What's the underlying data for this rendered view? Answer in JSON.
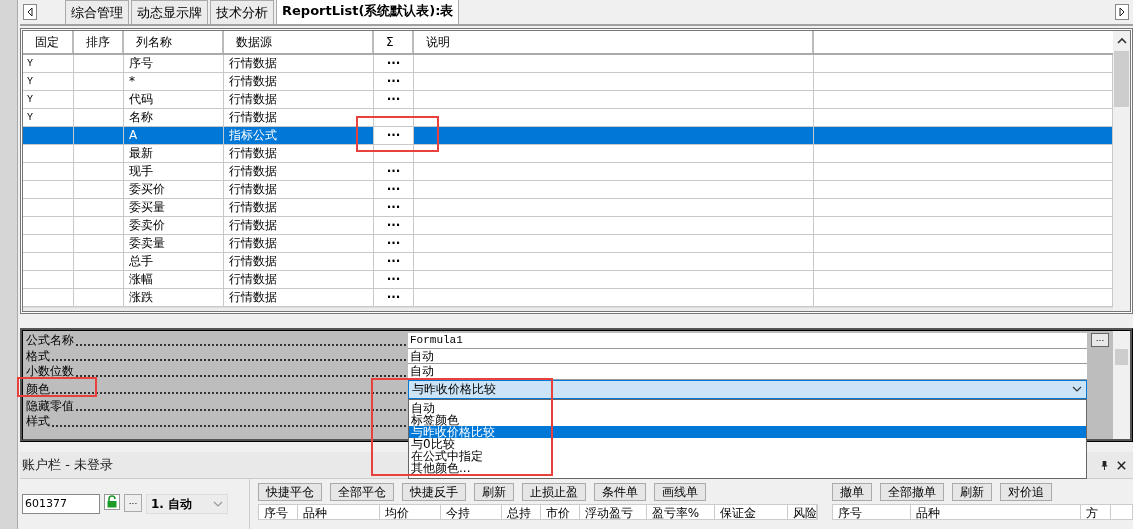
{
  "tabs": [
    {
      "label": "综合管理",
      "selected": false
    },
    {
      "label": "动态显示牌",
      "selected": false
    },
    {
      "label": "技术分析",
      "selected": false
    },
    {
      "label": "ReportList(系统默认表):表",
      "selected": true
    }
  ],
  "grid": {
    "columns": [
      "固定",
      "排序",
      "列名称",
      "数据源",
      "Σ",
      "说明"
    ],
    "rows": [
      {
        "fixed": "Y",
        "name": "序号",
        "source": "行情数据",
        "sum": "···",
        "selected": false
      },
      {
        "fixed": "Y",
        "name": "*",
        "source": "行情数据",
        "sum": "···",
        "selected": false
      },
      {
        "fixed": "Y",
        "name": "代码",
        "source": "行情数据",
        "sum": "···",
        "selected": false
      },
      {
        "fixed": "Y",
        "name": "名称",
        "source": "行情数据",
        "selected": false
      },
      {
        "name": "A",
        "source": "指标公式",
        "sum": "···",
        "selected": true,
        "highlighted": true
      },
      {
        "name": "最新",
        "source": "行情数据",
        "selected": false
      },
      {
        "name": "现手",
        "source": "行情数据",
        "sum": "···",
        "selected": false
      },
      {
        "name": "委买价",
        "source": "行情数据",
        "sum": "···",
        "selected": false
      },
      {
        "name": "委买量",
        "source": "行情数据",
        "sum": "···",
        "selected": false
      },
      {
        "name": "委卖价",
        "source": "行情数据",
        "sum": "···",
        "selected": false
      },
      {
        "name": "委卖量",
        "source": "行情数据",
        "sum": "···",
        "selected": false
      },
      {
        "name": "总手",
        "source": "行情数据",
        "sum": "···",
        "selected": false
      },
      {
        "name": "涨幅",
        "source": "行情数据",
        "sum": "···",
        "selected": false
      },
      {
        "name": "涨跌",
        "source": "行情数据",
        "sum": "···",
        "selected": false
      }
    ]
  },
  "properties": {
    "more_button": "...",
    "rows": [
      {
        "kind": "text",
        "label": "公式名称",
        "value": "Formula1"
      },
      {
        "kind": "text",
        "label": "格式",
        "value": "自动"
      },
      {
        "kind": "text",
        "label": "小数位数",
        "value": "自动"
      },
      {
        "kind": "combo",
        "label": "颜色",
        "value": "与昨收价格比较",
        "highlighted": true,
        "options": [
          {
            "label": "自动",
            "selected": false
          },
          {
            "label": "标签颜色",
            "selected": false
          },
          {
            "label": "与昨收价格比较",
            "selected": true
          },
          {
            "label": "与0比较",
            "selected": false
          },
          {
            "label": "在公式中指定",
            "selected": false
          },
          {
            "label": "其他颜色...",
            "selected": false
          }
        ]
      },
      {
        "kind": "hidden",
        "label": "隐藏零值"
      },
      {
        "kind": "hidden",
        "label": "样式"
      }
    ]
  },
  "account_bar": {
    "title": "账户栏 - 未登录"
  },
  "order_panel": {
    "code": "601377",
    "more_button": "...",
    "mode": "1. 自动",
    "buttons": [
      "快捷平仓",
      "全部平仓",
      "快捷反手",
      "刷新",
      "止损止盈",
      "条件单",
      "画线单"
    ],
    "right_buttons": [
      "撤单",
      "全部撤单",
      "刷新",
      "对价追"
    ],
    "positions_columns": [
      "序号",
      "品种",
      "均价",
      "今持",
      "总持",
      "市价",
      "浮动盈亏",
      "盈亏率%",
      "保证金",
      "风险"
    ],
    "orders_columns": [
      "序号",
      "品种",
      "方"
    ]
  }
}
